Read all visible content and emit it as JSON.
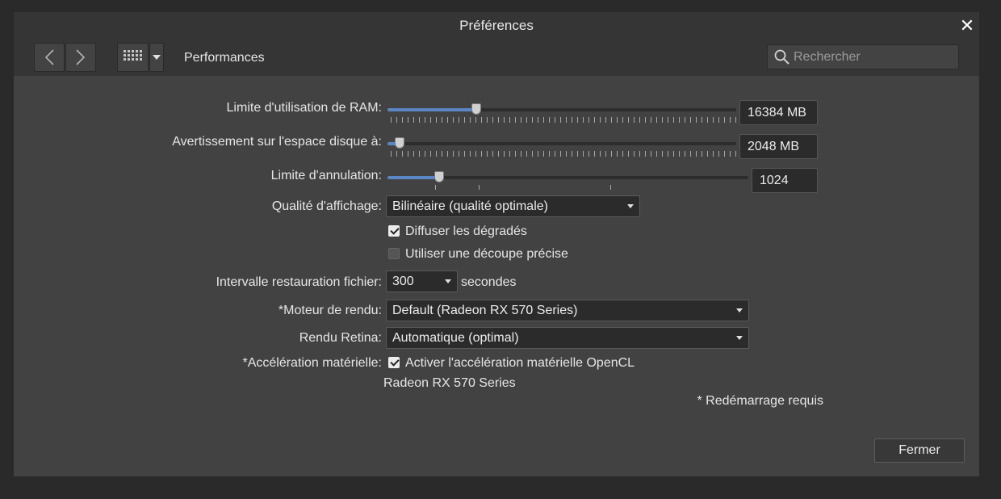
{
  "window": {
    "title": "Préférences"
  },
  "toolbar": {
    "section_label": "Performances",
    "search_placeholder": "Rechercher"
  },
  "settings": {
    "ram": {
      "label": "Limite d'utilisation de RAM:",
      "value": "16384 MB",
      "slider_fraction": 0.24
    },
    "disk": {
      "label": "Avertissement sur l'espace disque à:",
      "value": "2048 MB",
      "slider_fraction": 0.02
    },
    "undo": {
      "label": "Limite d'annulation:",
      "value": "1024",
      "slider_fraction": 0.13
    },
    "display_quality": {
      "label": "Qualité d'affichage:",
      "selected": "Bilinéaire (qualité optimale)"
    },
    "dither": {
      "label": "Diffuser les dégradés",
      "checked": true
    },
    "precise_clip": {
      "label": "Utiliser une découpe précise",
      "checked": false
    },
    "restore_interval": {
      "label": "Intervalle restauration fichier:",
      "selected": "300",
      "unit": "secondes"
    },
    "render_engine": {
      "label": "*Moteur de rendu:",
      "selected": "Default (Radeon RX 570 Series)"
    },
    "retina": {
      "label": "Rendu Retina:",
      "selected": "Automatique (optimal)"
    },
    "hw_accel": {
      "label": "*Accélération matérielle:",
      "checkbox_label": "Activer l'accélération matérielle OpenCL",
      "checked": true,
      "device": "Radeon RX 570 Series"
    },
    "restart_note": "* Redémarrage requis"
  },
  "footer": {
    "close_label": "Fermer"
  },
  "colors": {
    "accent": "#5b86c6",
    "background": "#424242",
    "chrome": "#353535"
  },
  "icons": [
    "close-icon",
    "back-icon",
    "forward-icon",
    "grid-icon",
    "chevron-down-icon",
    "search-icon"
  ]
}
